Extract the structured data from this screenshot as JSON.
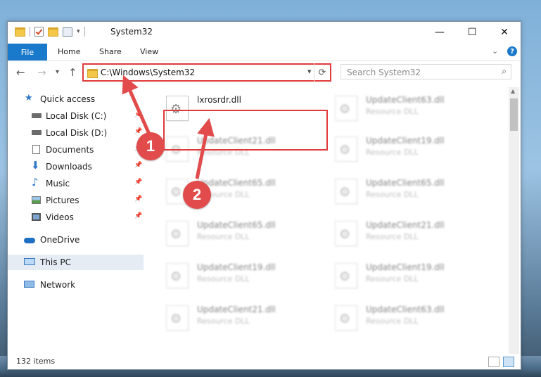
{
  "window": {
    "title": "System32"
  },
  "titlebar_buttons": {
    "minimize": "—",
    "maximize": "☐",
    "close": "✕"
  },
  "ribbon": {
    "tabs": [
      {
        "label": "File"
      },
      {
        "label": "Home"
      },
      {
        "label": "Share"
      },
      {
        "label": "View"
      }
    ],
    "help": "?"
  },
  "navigation": {
    "back": "←",
    "forward": "→",
    "recent": "▾",
    "up": "↑",
    "address": "C:\\Windows\\System32",
    "address_dropdown": "▾",
    "refresh": "⟳",
    "search_placeholder": "Search System32",
    "search_icon": "⌕"
  },
  "sidebar": {
    "items": [
      {
        "label": "Quick access",
        "icon": "star-icon"
      },
      {
        "label": "Local Disk (C:)",
        "icon": "drive-icon"
      },
      {
        "label": "Local Disk (D:)",
        "icon": "drive-icon"
      },
      {
        "label": "Documents",
        "icon": "documents-icon"
      },
      {
        "label": "Downloads",
        "icon": "download-icon"
      },
      {
        "label": "Music",
        "icon": "music-icon"
      },
      {
        "label": "Pictures",
        "icon": "pictures-icon"
      },
      {
        "label": "Videos",
        "icon": "videos-icon"
      },
      {
        "label": "OneDrive",
        "icon": "cloud-icon"
      },
      {
        "label": "This PC",
        "icon": "computer-icon"
      },
      {
        "label": "Network",
        "icon": "network-icon"
      }
    ],
    "pin": "📌"
  },
  "files": [
    {
      "name": "lxrosrdr.dll",
      "type": ""
    },
    {
      "name": "UpdateClient63.dll",
      "type": "Resource DLL"
    },
    {
      "name": "UpdateClient21.dll",
      "type": "Resource DLL"
    },
    {
      "name": "UpdateClient19.dll",
      "type": "Resource DLL"
    },
    {
      "name": "UpdateClient65.dll",
      "type": "Resource DLL"
    },
    {
      "name": "UpdateClient65.dll",
      "type": "Resource DLL"
    },
    {
      "name": "UpdateClient65.dll",
      "type": "Resource DLL"
    },
    {
      "name": "UpdateClient21.dll",
      "type": "Resource DLL"
    },
    {
      "name": "UpdateClient19.dll",
      "type": "Resource DLL"
    },
    {
      "name": "UpdateClient19.dll",
      "type": "Resource DLL"
    },
    {
      "name": "UpdateClient21.dll",
      "type": "Resource DLL"
    },
    {
      "name": "UpdateClient63.dll",
      "type": "Resource DLL"
    }
  ],
  "gear_glyph": "⚙",
  "status": {
    "item_count": "132 items"
  },
  "annotations": [
    {
      "label": "1"
    },
    {
      "label": "2"
    }
  ],
  "colors": {
    "accent": "#1979ca",
    "highlight": "#e03a3a",
    "badge": "#e14b4b"
  }
}
